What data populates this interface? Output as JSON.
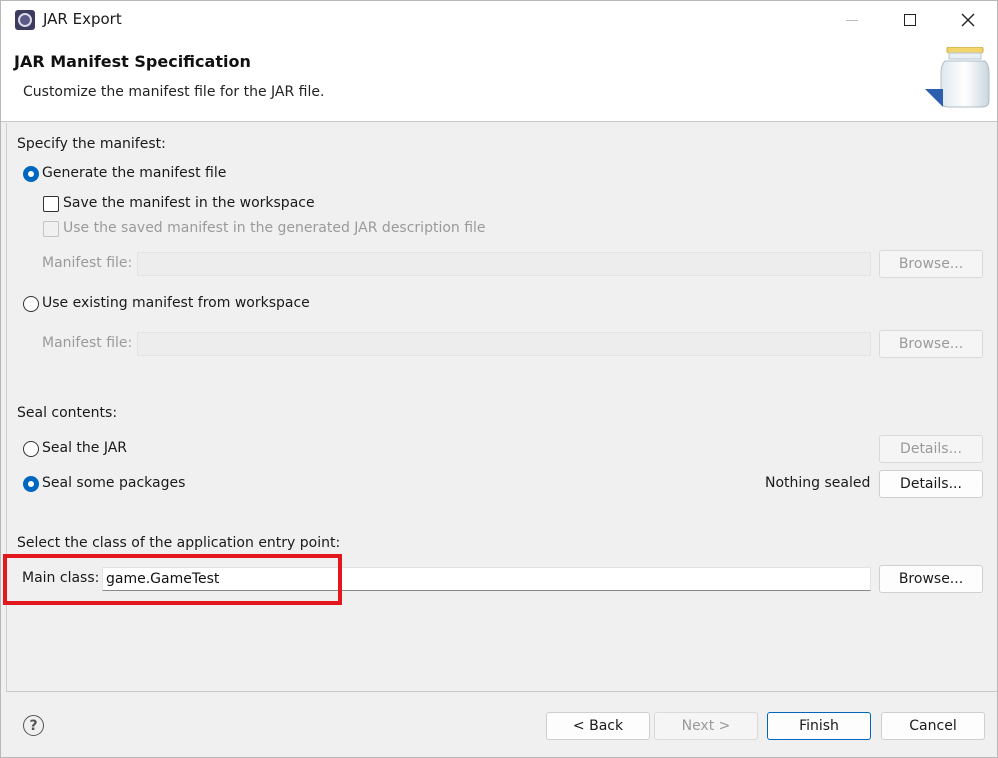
{
  "window": {
    "title": "JAR Export",
    "controls": {
      "minimize": "minimize-icon",
      "maximize": "maximize-icon",
      "close": "close-icon"
    }
  },
  "header": {
    "title": "JAR Manifest Specification",
    "description": "Customize the manifest file for the JAR file."
  },
  "manifest": {
    "section_label": "Specify the manifest:",
    "generate_label": "Generate the manifest file",
    "generate_selected": true,
    "save_in_workspace_label": "Save the manifest in the workspace",
    "save_in_workspace_checked": false,
    "use_saved_label": "Use the saved manifest in the generated JAR description file",
    "use_saved_checked": false,
    "manifest_file_label_1": "Manifest file:",
    "manifest_file_value_1": "",
    "browse_label_1": "Browse...",
    "use_existing_label": "Use existing manifest from workspace",
    "use_existing_selected": false,
    "manifest_file_label_2": "Manifest file:",
    "manifest_file_value_2": "",
    "browse_label_2": "Browse..."
  },
  "seal": {
    "section_label": "Seal contents:",
    "seal_jar_label": "Seal the JAR",
    "seal_jar_selected": false,
    "seal_jar_details_label": "Details...",
    "seal_packages_label": "Seal some packages",
    "seal_packages_selected": true,
    "sealed_status": "Nothing sealed",
    "seal_packages_details_label": "Details..."
  },
  "entry_point": {
    "section_label": "Select the class of the application entry point:",
    "main_class_label": "Main class:",
    "main_class_value": "game.GameTest",
    "browse_label": "Browse..."
  },
  "footer": {
    "help_icon": "help-icon",
    "help_glyph": "?",
    "back_label": "< Back",
    "next_label": "Next >",
    "finish_label": "Finish",
    "cancel_label": "Cancel"
  },
  "colors": {
    "accent": "#0067c0",
    "highlight": "#e3181f",
    "disabled_text": "#9a9a9a"
  }
}
